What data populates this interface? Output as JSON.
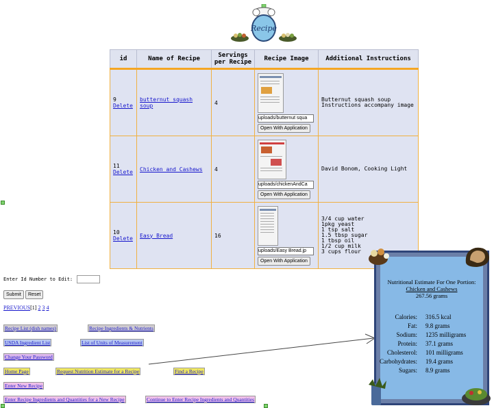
{
  "logo": {
    "text": "Recipe"
  },
  "table": {
    "headers": [
      "id",
      "Name of Recipe",
      "Servings per Recipe",
      "Recipe Image",
      "Additional Instructions"
    ],
    "delete_label": "Delete",
    "open_button": "Open With Application",
    "rows": [
      {
        "id": "9",
        "name": "butternut squash soup",
        "servings": "4",
        "file": "uploads/butternut squa",
        "instructions": "Butternut squash soup\nInstructions accompany image"
      },
      {
        "id": "11",
        "name": "Chicken and Cashews",
        "servings": "4",
        "file": "uploads/chickenAndCa",
        "instructions": "David Bonom, Cooking Light"
      },
      {
        "id": "10",
        "name": "Easy Bread",
        "servings": "16",
        "file": "uploads/Easy Bread.jp",
        "instructions": "3/4 cup water\n1pkg yeast\n1 tsp salt\n1.5 tbsp sugar\n1 tbsp oil\n1/2 cup milk\n3 cups flour"
      }
    ]
  },
  "edit": {
    "label": "Enter Id Number to Edit:",
    "submit": "Submit",
    "reset": "Reset"
  },
  "pager": {
    "previous": "PREVIOUS",
    "current": "[1]",
    "pages": [
      "2",
      "3",
      "4"
    ]
  },
  "nav": {
    "recipe_list": "Recipe List (dish names)",
    "recipe_ingredients": "Recipe Ingredients & Nutrients",
    "usda_list": "USDA Ingredient List",
    "units_list": "List of Units of Measurement",
    "change_password": "Change Your Password",
    "home": "Home Page",
    "request_nutrition": "Request Nutrition Estimate for a Recipe",
    "find_recipe": "Find a Recipe",
    "enter_new": "Enter New Recipe",
    "enter_ingredients": "Enter Recipe Ingredients and Quantities for a New Recipe",
    "continue_ingredients": "Continue to Enter Recipe Ingredients and Quantities"
  },
  "nutrition": {
    "title": "Nutritional Estimate For One Portion:",
    "recipe": "Chicken and Cashews",
    "weight": "267.56 grams",
    "rows": [
      {
        "label": "Calories:",
        "value": "316.5 kcal"
      },
      {
        "label": "Fat:",
        "value": "9.8 grams"
      },
      {
        "label": "Sodium:",
        "value": "1235 milligrams"
      },
      {
        "label": "Protein:",
        "value": "37.1 grams"
      },
      {
        "label": "Cholesterol:",
        "value": "101 milligrams"
      },
      {
        "label": "Carbohydrates:",
        "value": "19.4 grams"
      },
      {
        "label": "Sugars:",
        "value": "8.9 grams"
      }
    ]
  }
}
